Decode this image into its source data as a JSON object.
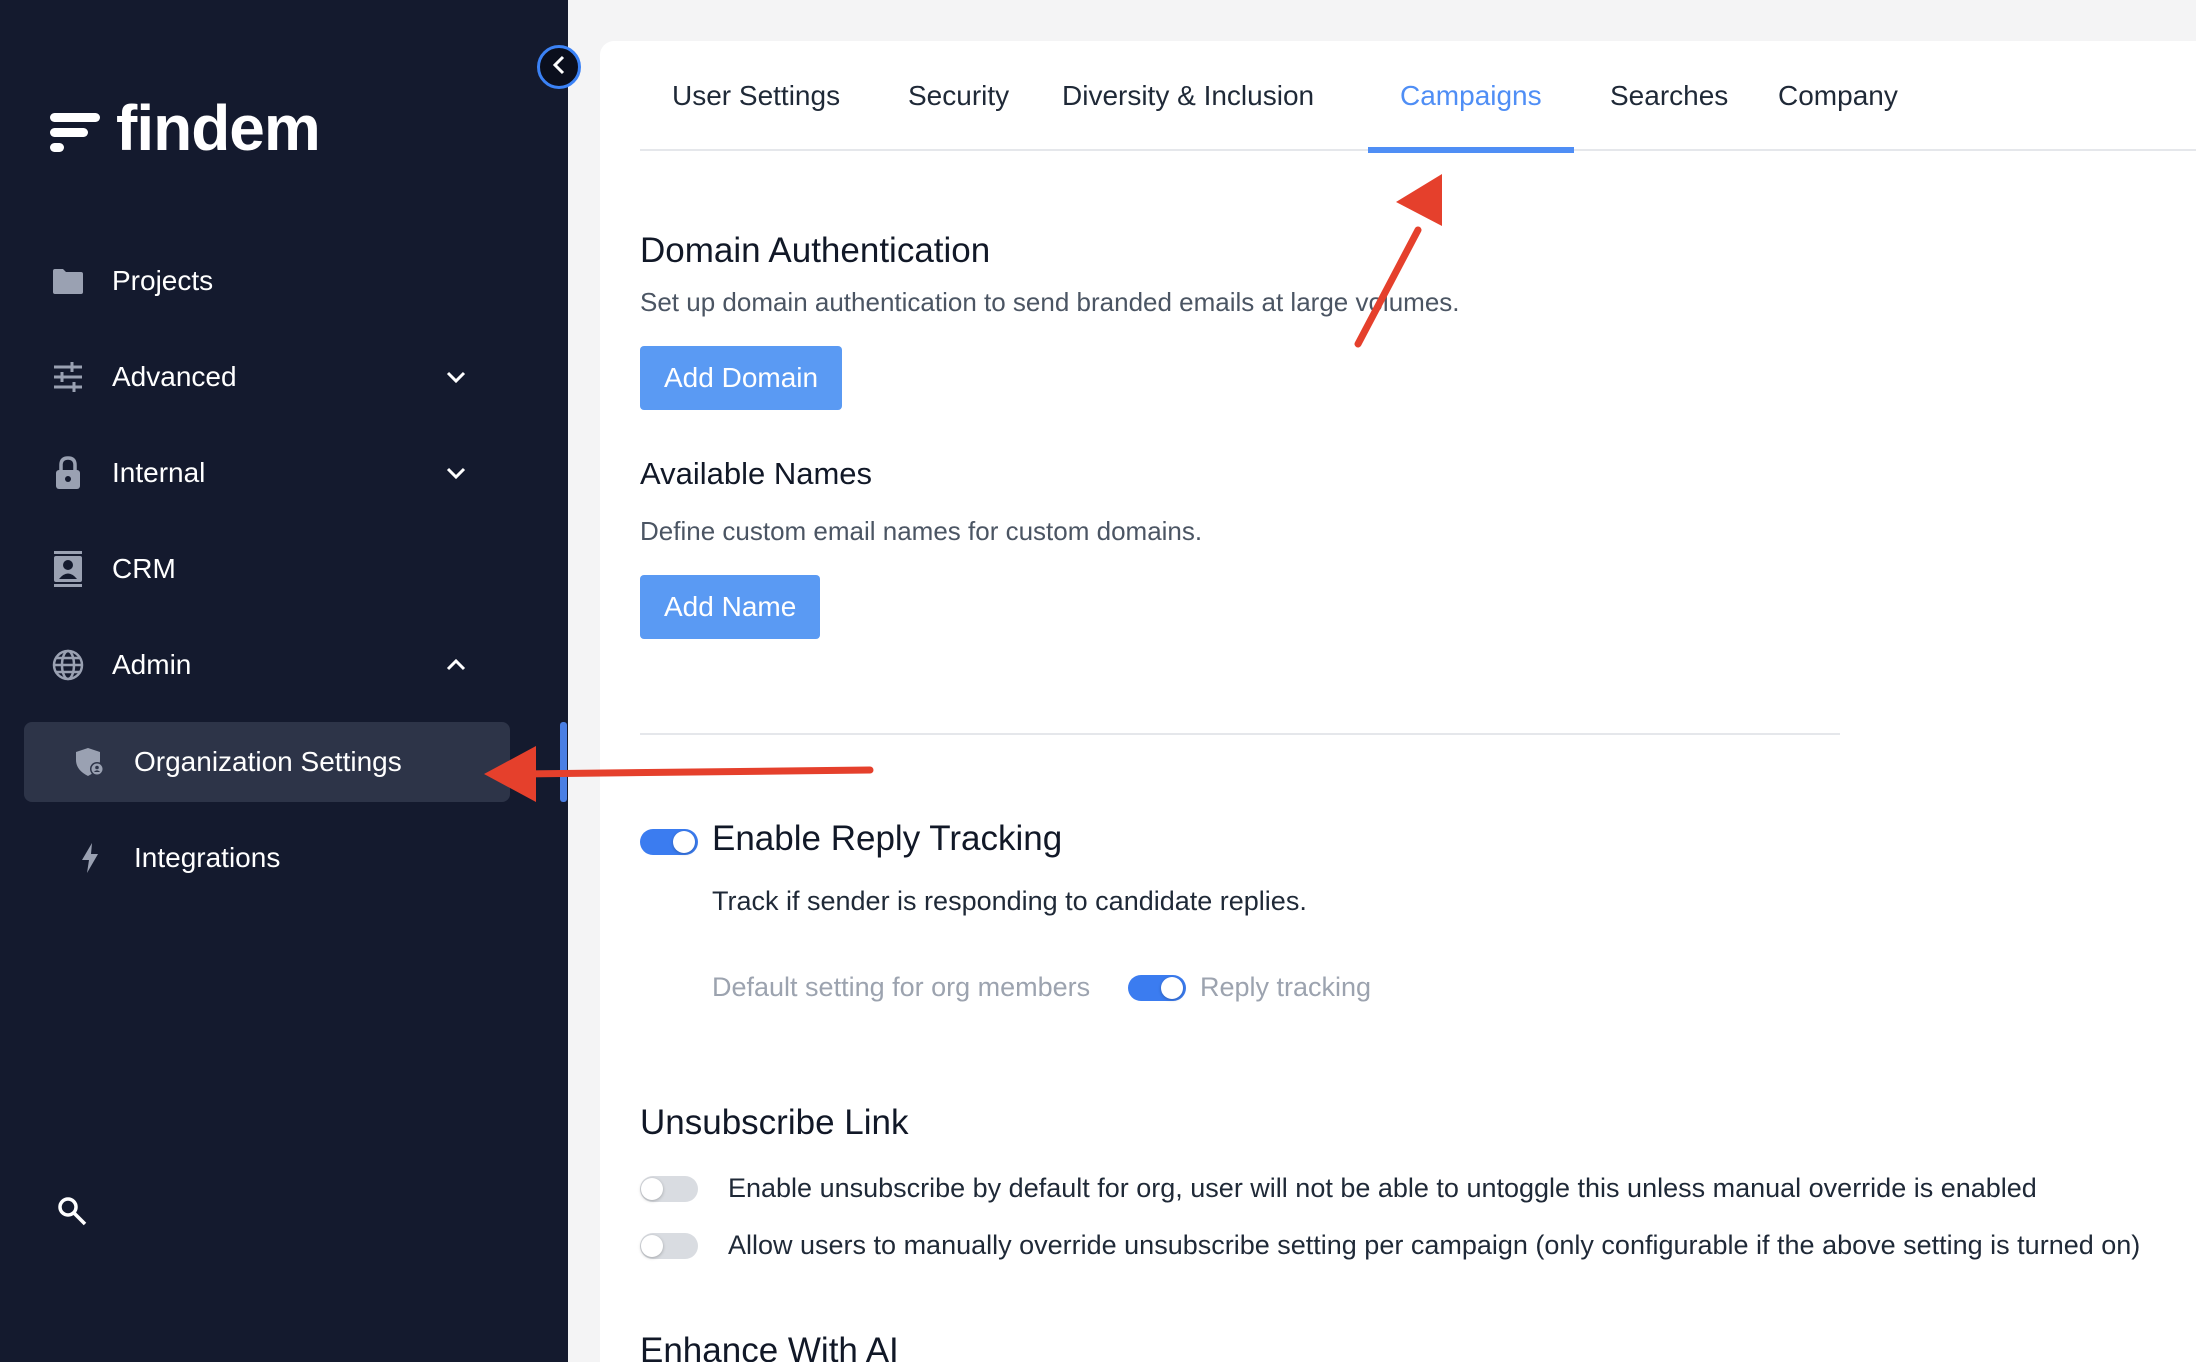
{
  "brand": {
    "name": "findem"
  },
  "sidebar": {
    "items": [
      {
        "label": "Projects",
        "icon": "folder-icon"
      },
      {
        "label": "Advanced",
        "icon": "sliders-icon"
      },
      {
        "label": "Internal",
        "icon": "lock-icon"
      },
      {
        "label": "CRM",
        "icon": "contact-card-icon"
      },
      {
        "label": "Admin",
        "icon": "globe-icon"
      },
      {
        "label": "Organization Settings",
        "icon": "shield-user-icon"
      },
      {
        "label": "Integrations",
        "icon": "bolt-icon"
      }
    ]
  },
  "tabs": [
    {
      "label": "User Settings"
    },
    {
      "label": "Security"
    },
    {
      "label": "Diversity & Inclusion"
    },
    {
      "label": "Campaigns"
    },
    {
      "label": "Searches"
    },
    {
      "label": "Company"
    }
  ],
  "domain_auth": {
    "title": "Domain Authentication",
    "description": "Set up domain authentication to send branded emails at large volumes.",
    "button": "Add Domain"
  },
  "available_names": {
    "title": "Available Names",
    "description": "Define custom email names for custom domains.",
    "button": "Add Name"
  },
  "reply_tracking": {
    "title": "Enable Reply Tracking",
    "description": "Track if sender is responding to candidate replies.",
    "default_label": "Default setting for org members",
    "toggle_label": "Reply tracking",
    "enabled": true,
    "default_enabled": true
  },
  "unsubscribe": {
    "title": "Unsubscribe Link",
    "option1": "Enable unsubscribe by default for org, user will not be able to untoggle this unless manual override is enabled",
    "option2": "Allow users to manually override unsubscribe setting per campaign (only configurable if the above setting is turned on)",
    "option1_enabled": false,
    "option2_enabled": false
  },
  "enhance_ai": {
    "title": "Enhance With AI"
  },
  "colors": {
    "sidebar_bg": "#141a2e",
    "accent": "#4f8ef5",
    "button": "#5a9af3",
    "annotation_arrow": "#e5402c"
  }
}
